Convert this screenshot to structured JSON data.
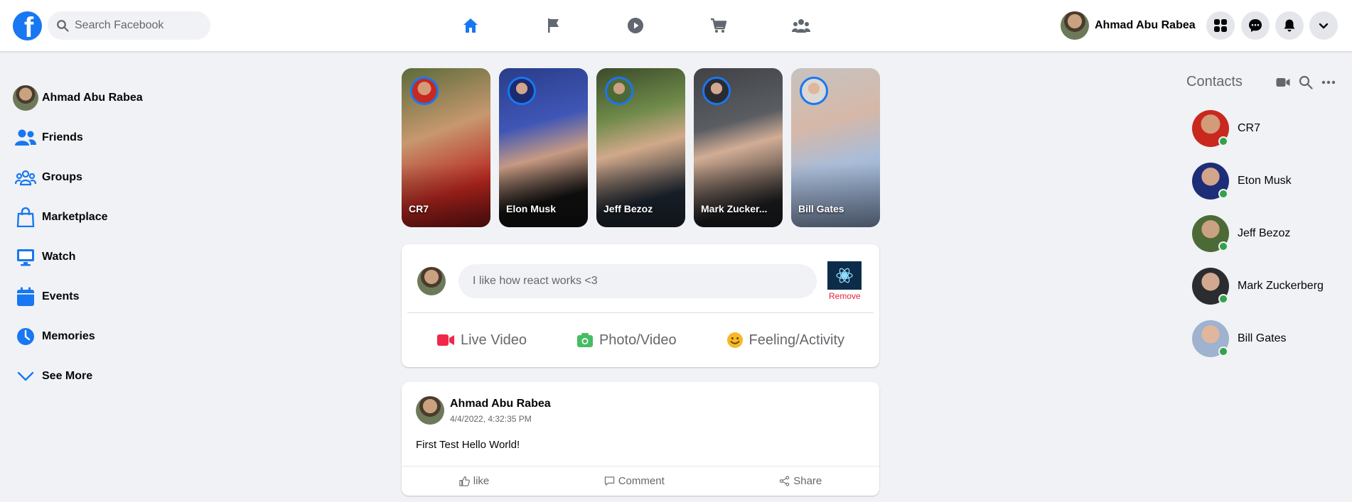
{
  "header": {
    "logo_letter": "f",
    "search_placeholder": "Search Facebook",
    "user_name": "Ahmad Abu Rabea",
    "nav_icons": [
      "home-icon",
      "flag-icon",
      "watch-icon",
      "marketplace-icon",
      "groups-icon"
    ],
    "right_buttons": [
      "menu-grid-icon",
      "messenger-icon",
      "bell-icon",
      "chevron-down-icon"
    ],
    "accent_color": "#1877f2"
  },
  "sidebar": {
    "items": [
      {
        "label": "Ahmad Abu Rabea",
        "icon": "avatar"
      },
      {
        "label": "Friends",
        "icon": "friends-icon"
      },
      {
        "label": "Groups",
        "icon": "groups-icon"
      },
      {
        "label": "Marketplace",
        "icon": "marketplace-bag-icon"
      },
      {
        "label": "Watch",
        "icon": "watch-monitor-icon"
      },
      {
        "label": "Events",
        "icon": "calendar-icon"
      },
      {
        "label": "Memories",
        "icon": "clock-icon"
      },
      {
        "label": "See More",
        "icon": "chevron-down-icon"
      }
    ]
  },
  "stories": [
    {
      "name": "CR7"
    },
    {
      "name": "Elon Musk"
    },
    {
      "name": "Jeff Bezoz"
    },
    {
      "name": "Mark Zucker..."
    },
    {
      "name": "Bill Gates"
    }
  ],
  "composer": {
    "input_value": "I like how react works <3",
    "remove_label": "Remove",
    "actions": [
      {
        "label": "Live Video",
        "color": "#f02849"
      },
      {
        "label": "Photo/Video",
        "color": "#45bd62"
      },
      {
        "label": "Feeling/Activity",
        "color": "#f7b928"
      }
    ]
  },
  "post": {
    "author": "Ahmad Abu Rabea",
    "timestamp": "4/4/2022, 4:32:35 PM",
    "text": "First Test Hello World!",
    "actions": [
      "like",
      "Comment",
      "Share"
    ]
  },
  "contacts": {
    "title": "Contacts",
    "items": [
      {
        "name": "CR7",
        "online": true
      },
      {
        "name": "Eton Musk",
        "online": true
      },
      {
        "name": "Jeff Bezoz",
        "online": true
      },
      {
        "name": "Mark Zuckerberg",
        "online": true
      },
      {
        "name": "Bill Gates",
        "online": true
      }
    ]
  }
}
